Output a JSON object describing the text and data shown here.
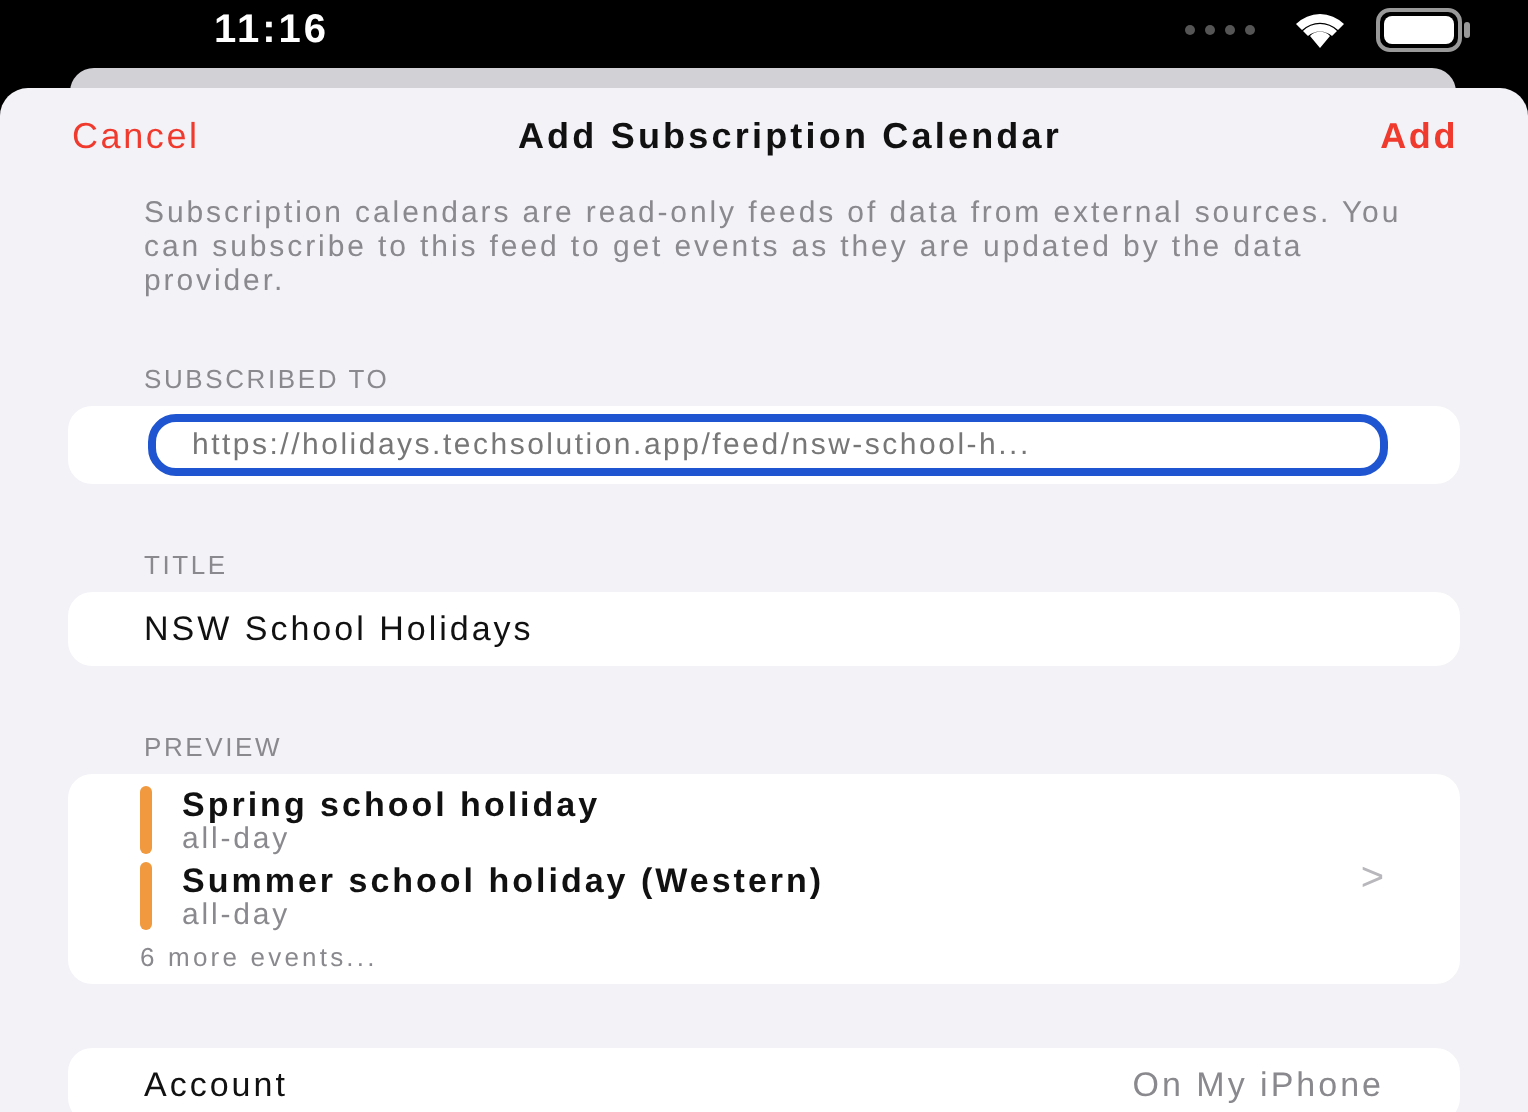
{
  "status_bar": {
    "time": "11:16"
  },
  "nav": {
    "cancel": "Cancel",
    "title": "Add Subscription Calendar",
    "add": "Add"
  },
  "description": "Subscription calendars are read-only feeds of data from external sources. You can subscribe to this feed to get events as they are updated by the data provider.",
  "subscribed_to": {
    "header": "SUBSCRIBED TO",
    "value": "https://holidays.techsolution.app/feed/nsw-school-h...",
    "focused": true
  },
  "title_section": {
    "header": "TITLE",
    "value": "NSW School Holidays"
  },
  "preview": {
    "header": "PREVIEW",
    "events": [
      {
        "name": "Spring school holiday",
        "time": "all-day",
        "color": "#f0993e"
      },
      {
        "name": "Summer school holiday (Western)",
        "time": "all-day",
        "color": "#f0993e"
      }
    ],
    "more": "6 more events...",
    "chevron": ">"
  },
  "account": {
    "label": "Account",
    "value": "On My iPhone"
  }
}
